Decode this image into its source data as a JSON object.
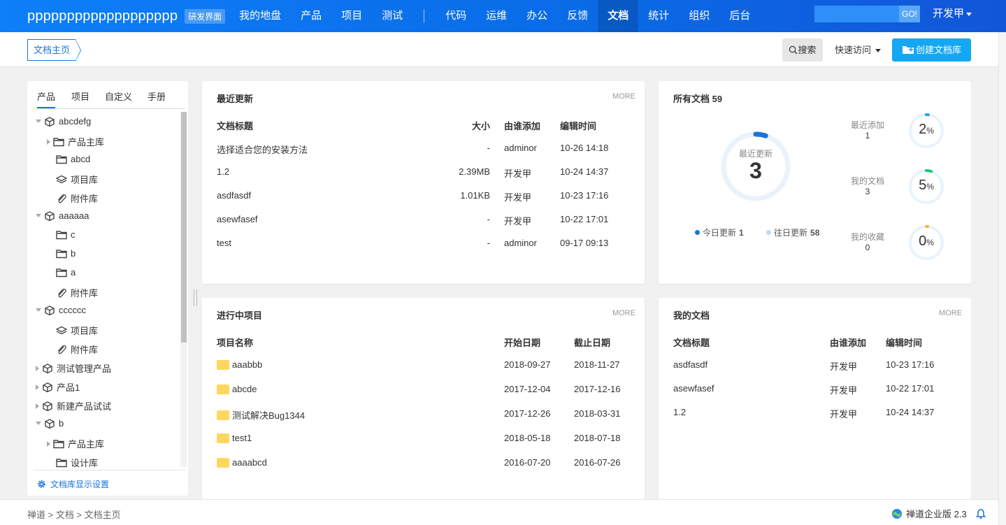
{
  "header": {
    "brand": "ppppppppppppppppppp",
    "dev_badge": "研发界面",
    "nav_left": [
      "我的地盘",
      "产品",
      "项目",
      "测试"
    ],
    "nav_right": [
      "代码",
      "运维",
      "办公",
      "反馈",
      "文档",
      "统计",
      "组织",
      "后台"
    ],
    "active_nav": "文档",
    "search_placeholder": "",
    "go_label": "GO!",
    "user_label": "开发甲"
  },
  "subbar": {
    "breadcrumb": "文档主页",
    "search_label": "搜索",
    "quick_label": "快速访问",
    "create_label": "创建文档库"
  },
  "sidebar": {
    "tabs": [
      "产品",
      "项目",
      "自定义",
      "手册"
    ],
    "active_tab": "产品",
    "tree": [
      {
        "label": "abcdefg",
        "level": 0,
        "icon": "cube-icon",
        "toggle": "down"
      },
      {
        "label": "产品主库",
        "level": 1,
        "icon": "folder-icon",
        "toggle": "right"
      },
      {
        "label": "abcd",
        "level": 1,
        "icon": "folder-icon",
        "toggle": "none"
      },
      {
        "label": "项目库",
        "level": 1,
        "icon": "layers-icon",
        "toggle": "none"
      },
      {
        "label": "附件库",
        "level": 1,
        "icon": "paperclip-icon",
        "toggle": "none"
      },
      {
        "label": "aaaaaa",
        "level": 0,
        "icon": "cube-icon",
        "toggle": "down"
      },
      {
        "label": "c",
        "level": 1,
        "icon": "folder-icon",
        "toggle": "none"
      },
      {
        "label": "b",
        "level": 1,
        "icon": "folder-icon",
        "toggle": "none"
      },
      {
        "label": "a",
        "level": 1,
        "icon": "folder-icon",
        "toggle": "none"
      },
      {
        "label": "附件库",
        "level": 1,
        "icon": "paperclip-icon",
        "toggle": "none"
      },
      {
        "label": "cccccc",
        "level": 0,
        "icon": "cube-icon",
        "toggle": "down"
      },
      {
        "label": "项目库",
        "level": 1,
        "icon": "layers-icon",
        "toggle": "none"
      },
      {
        "label": "附件库",
        "level": 1,
        "icon": "paperclip-icon",
        "toggle": "none"
      },
      {
        "label": "测试管理产品",
        "level": 0,
        "icon": "cube-icon",
        "toggle": "right"
      },
      {
        "label": "产品1",
        "level": 0,
        "icon": "cube-icon",
        "toggle": "right"
      },
      {
        "label": "新建产品试试",
        "level": 0,
        "icon": "cube-icon",
        "toggle": "right"
      },
      {
        "label": "b",
        "level": 0,
        "icon": "cube-icon",
        "toggle": "down"
      },
      {
        "label": "产品主库",
        "level": 1,
        "icon": "folder-icon",
        "toggle": "right"
      },
      {
        "label": "设计库",
        "level": 1,
        "icon": "folder-icon",
        "toggle": "none"
      }
    ],
    "footer_link": "文档库显示设置"
  },
  "recent": {
    "title": "最近更新",
    "more": "MORE",
    "headers": [
      "文档标题",
      "大小",
      "由谁添加",
      "编辑时间"
    ],
    "rows": [
      [
        "选择适合您的安装方法",
        "-",
        "adminor",
        "10-26 14:18"
      ],
      [
        "1.2",
        "2.39MB",
        "开发甲",
        "10-24 14:37"
      ],
      [
        "asdfasdf",
        "1.01KB",
        "开发甲",
        "10-23 17:16"
      ],
      [
        "asewfasef",
        "-",
        "开发甲",
        "10-22 17:01"
      ],
      [
        "test",
        "-",
        "adminor",
        "09-17 09:13"
      ]
    ]
  },
  "alldocs": {
    "title": "所有文档",
    "count": "59",
    "donut_label": "最近更新",
    "donut_value": "3",
    "donut_fraction": 0.05,
    "legend": [
      {
        "label": "今日更新",
        "value": "1",
        "color": "#1a73d9"
      },
      {
        "label": "往日更新",
        "value": "58",
        "color": "#bcd8f5"
      }
    ],
    "stats": [
      {
        "label": "最近添加",
        "value": "1",
        "pct": "2",
        "unit": "%",
        "fraction": 0.02,
        "color": "#14a8f4"
      },
      {
        "label": "我的文档",
        "value": "3",
        "pct": "5",
        "unit": "%",
        "fraction": 0.05,
        "color": "#19c87d"
      },
      {
        "label": "我的收藏",
        "value": "0",
        "pct": "0",
        "unit": "%",
        "fraction": 0.0,
        "color": "#f7b733"
      }
    ]
  },
  "projects": {
    "title": "进行中项目",
    "more": "MORE",
    "headers": [
      "项目名称",
      "开始日期",
      "截止日期"
    ],
    "rows": [
      [
        "aaabbb",
        "2018-09-27",
        "2018-11-27"
      ],
      [
        "abcde",
        "2017-12-04",
        "2017-12-16"
      ],
      [
        "测试解决Bug1344",
        "2017-12-26",
        "2018-03-31"
      ],
      [
        "test1",
        "2018-05-18",
        "2018-07-18"
      ],
      [
        "aaaabcd",
        "2016-07-20",
        "2016-07-26"
      ]
    ]
  },
  "mydocs": {
    "title": "我的文档",
    "more": "MORE",
    "headers": [
      "文档标题",
      "由谁添加",
      "编辑时间"
    ],
    "rows": [
      [
        "asdfasdf",
        "开发甲",
        "10-23 17:16"
      ],
      [
        "asewfasef",
        "开发甲",
        "10-22 17:01"
      ],
      [
        "1.2",
        "开发甲",
        "10-24 14:37"
      ]
    ]
  },
  "footer": {
    "crumbs": "禅道 > 文档 > 文档主页",
    "version": "禅道企业版 2.3"
  }
}
